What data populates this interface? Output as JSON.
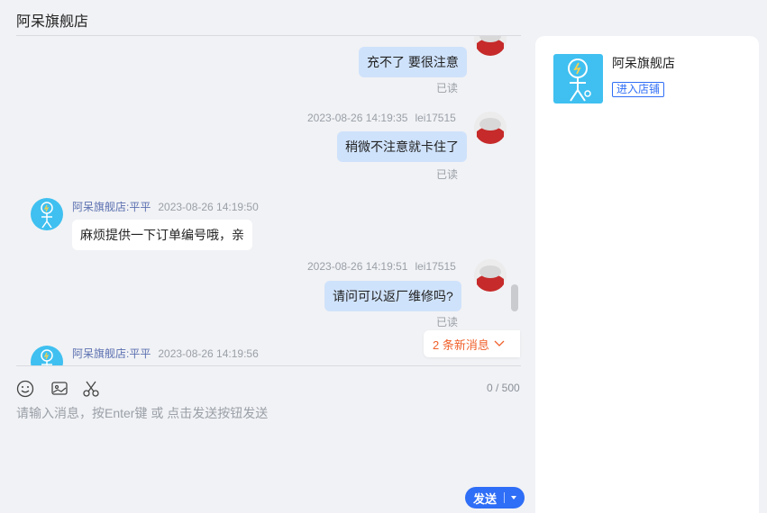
{
  "header": {
    "title": "阿呆旗舰店"
  },
  "messages": [
    {
      "from": "user",
      "text": "充不了 要很注意",
      "status": "已读"
    },
    {
      "from": "user",
      "time": "2023-08-26 14:19:35",
      "sender": "lei17515",
      "text": "稍微不注意就卡住了",
      "status": "已读"
    },
    {
      "from": "shop",
      "sender": "阿呆旗舰店:平平",
      "time": "2023-08-26 14:19:50",
      "text": "麻烦提供一下订单编号哦，亲"
    },
    {
      "from": "user",
      "time": "2023-08-26 14:19:51",
      "sender": "lei17515",
      "text": "请问可以返厂维修吗?",
      "status": "已读"
    },
    {
      "from": "shop",
      "sender": "阿呆旗舰店:平平",
      "time": "2023-08-26 14:19:56"
    }
  ],
  "new_messages_label": "2 条新消息",
  "input": {
    "counter": "0 / 500",
    "placeholder": "请输入消息，按Enter键 或 点击发送按钮发送",
    "send_label": "发送",
    "tools": [
      "emoji-icon",
      "image-icon",
      "scissors-icon"
    ]
  },
  "store": {
    "name": "阿呆旗舰店",
    "enter_label": "进入店铺"
  },
  "colors": {
    "accent": "#2f6ef6",
    "bubble_mine": "#cfe2fb",
    "new_msg": "#f0602b",
    "shop_avatar": "#3fc0f0"
  }
}
